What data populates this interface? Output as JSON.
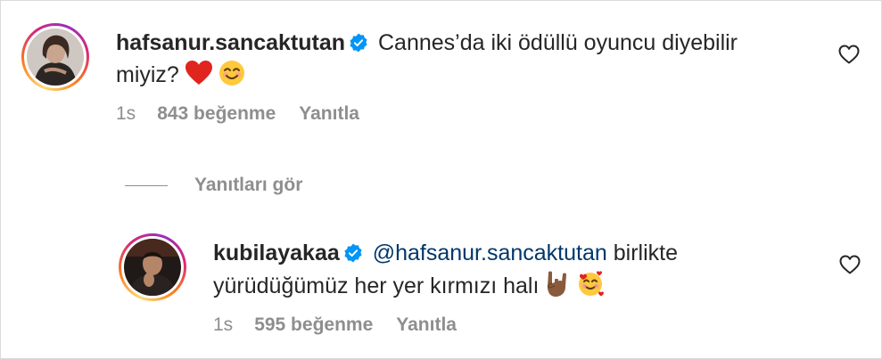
{
  "comments": [
    {
      "username": "hafsanur.sancaktutan",
      "verified": true,
      "text": "Cannes’da iki ödüllü oyuncu diyebilir miyiz?",
      "emojis": [
        "red-heart",
        "smiling-face"
      ],
      "time": "1s",
      "likes": "843 beğenme",
      "reply_label": "Yanıtla"
    },
    {
      "username": "kubilayakaa",
      "verified": true,
      "mention": "@hafsanur.sancaktutan",
      "text": "birlikte yürüdüğümüz her yer kırmızı halı",
      "emojis": [
        "sign-of-horns",
        "smiling-face-with-hearts"
      ],
      "time": "1s",
      "likes": "595 beğenme",
      "reply_label": "Yanıtla"
    }
  ],
  "view_replies_label": "Yanıtları gör",
  "colors": {
    "text": "#262626",
    "secondary": "#8e8e8e",
    "mention": "#00376b",
    "verified": "#0095f6"
  }
}
